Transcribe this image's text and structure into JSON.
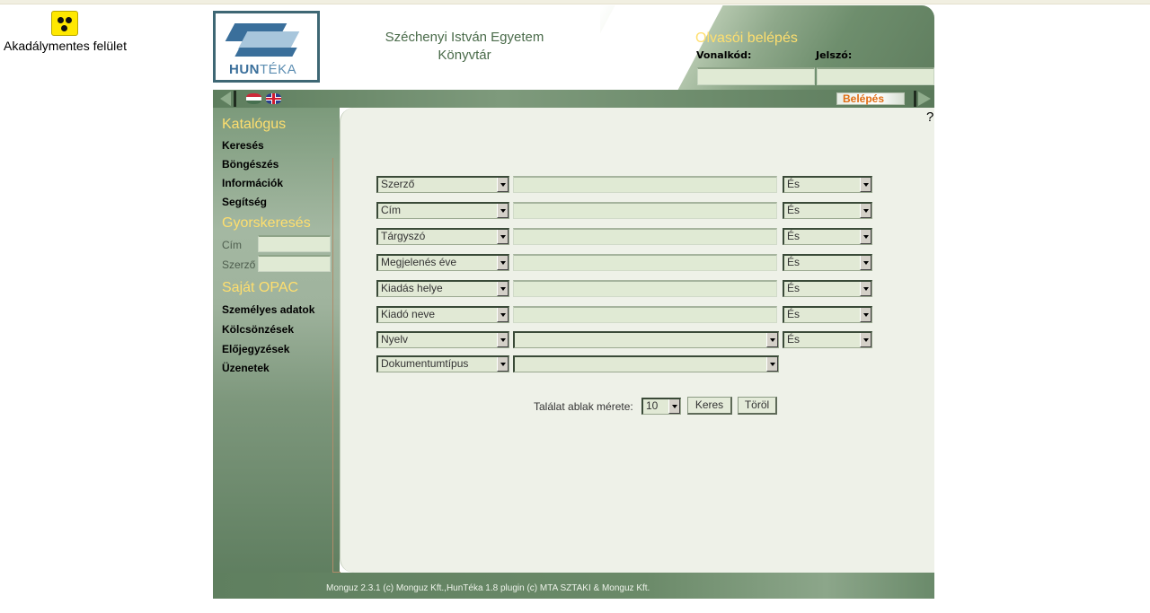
{
  "accessibility": {
    "label": "Akadálymentes felület",
    "icon": "accessibility-icon"
  },
  "header": {
    "logo": {
      "hun": "HUN",
      "teka": "TÉKA"
    },
    "university_line1": "Széchenyi István Egyetem",
    "university_line2": "Könyvtár",
    "login_title": "Olvasói belépés",
    "barcode_label": "Vonalkód:",
    "password_label": "Jelszó:"
  },
  "navbar": {
    "login_button": "Belépés",
    "languages": [
      "hu",
      "en"
    ]
  },
  "sidebar": {
    "catalog_heading": "Katalógus",
    "catalog_links": [
      "Keresés",
      "Böngészés",
      "Információk",
      "Segítség"
    ],
    "quicksearch_heading": "Gyorskeresés",
    "quicksearch_fields": [
      "Cím",
      "Szerző"
    ],
    "opac_heading": "Saját OPAC",
    "opac_links": [
      "Személyes adatok",
      "Kölcsönzések",
      "Előjegyzések",
      "Üzenetek"
    ]
  },
  "content": {
    "help": "?",
    "rows": [
      {
        "field": "Szerző",
        "operator": "És"
      },
      {
        "field": "Cím",
        "operator": "És"
      },
      {
        "field": "Tárgyszó",
        "operator": "És"
      },
      {
        "field": "Megjelenés éve",
        "operator": "És"
      },
      {
        "field": "Kiadás helye",
        "operator": "És"
      },
      {
        "field": "Kiadó neve",
        "operator": "És"
      },
      {
        "field": "Nyelv",
        "operator": "És"
      },
      {
        "field": "Dokumentumtípus"
      }
    ],
    "result_window_label": "Találat ablak mérete:",
    "result_window_value": "10",
    "search_button": "Keres",
    "clear_button": "Töröl"
  },
  "footer": {
    "text": "Monguz 2.3.1 (c) Monguz Kft.,HunTéka 1.8 plugin (c) MTA SZTAKI & Monguz Kft."
  },
  "colors": {
    "accent_yellow": "#ffdf6e",
    "panel_green": "#6e8e6d",
    "content_bg": "#eef1e8",
    "input_bg": "#e0ead4",
    "login_orange": "#e06c12"
  }
}
